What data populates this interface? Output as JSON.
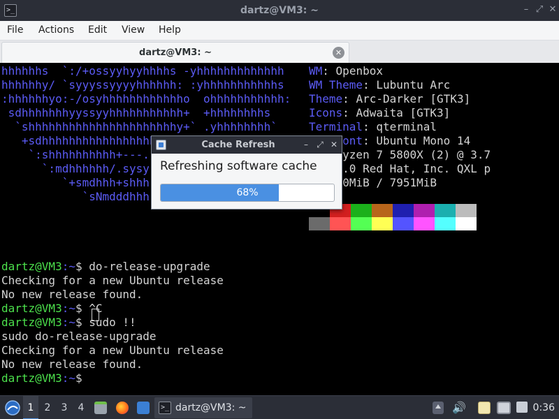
{
  "window": {
    "title": "dartz@VM3: ~",
    "app_icon": "terminal-icon",
    "controls": [
      "minimize-icon",
      "maximize-icon",
      "close-icon"
    ]
  },
  "menu": {
    "items": [
      "File",
      "Actions",
      "Edit",
      "View",
      "Help"
    ]
  },
  "tab": {
    "title": "dartz@VM3: ~",
    "close_icon": "tab-close-icon"
  },
  "terminal": {
    "logo_lines": [
      "hhhhhhs  `:/+ossyyhyyhhhhs -yhhhhhhhhhhhhh",
      "hhhhhhy/ `syyyssyyyyhhhhhh: :yhhhhhhhhhhhs",
      ":hhhhhhyo:-/osyhhhhhhhhhhhho  ohhhhhhhhhhh:",
      " sdhhhhhhhyyssyyhhhhhhhhhhh+  +hhhhhhhhs",
      "  `shhhhhhhhhhhhhhhhhhhhhhy+` .yhhhhhhhh`",
      "   +sdhhhhhhhhhhhhhhhhhhhh",
      "    `:shhhhhhhhhh+---.",
      "      `:mdhhhhhh/.sysy",
      "         `+smdhhh+shhh",
      "            `sNmdddhhh"
    ],
    "info": [
      {
        "key": "WM",
        "value": "Openbox"
      },
      {
        "key": "WM Theme",
        "value": "Lubuntu Arc"
      },
      {
        "key": "Theme",
        "value": "Arc-Darker [GTK3]"
      },
      {
        "key": "Icons",
        "value": "Adwaita [GTK3]"
      },
      {
        "key": "Terminal",
        "value": "qterminal"
      },
      {
        "key": "nal Font",
        "value": "Ubuntu Mono 14"
      },
      {
        "key": "",
        "value": "AMD Ryzen 7 5800X (2) @ 3.7"
      },
      {
        "key": "",
        "value": "00:01.0 Red Hat, Inc. QXL p"
      },
      {
        "key": "y",
        "value": "350MiB / 7951MiB"
      }
    ],
    "info_separators": [
      ":",
      ":",
      ":",
      ":",
      ":",
      ":",
      "",
      "",
      ":"
    ],
    "palette_top": [
      "#000000",
      "#d21f1f",
      "#1bb01b",
      "#b8651b",
      "#1f1fb0",
      "#b01fb0",
      "#1bb0b0",
      "#bcbcbc"
    ],
    "palette_bottom": [
      "#6b6b6b",
      "#ff5454",
      "#54ff54",
      "#ffff54",
      "#5454ff",
      "#ff54ff",
      "#54ffff",
      "#ffffff"
    ],
    "prompt_user": "dartz@VM3",
    "prompt_path": ":~",
    "prompt_symbol": "$ ",
    "lines": [
      {
        "type": "prompt",
        "cmd": "do-release-upgrade"
      },
      {
        "type": "out",
        "text": "Checking for a new Ubuntu release"
      },
      {
        "type": "out",
        "text": "No new release found."
      },
      {
        "type": "prompt",
        "cmd": "^C"
      },
      {
        "type": "prompt",
        "cmd": "sudo !!"
      },
      {
        "type": "out",
        "text": "sudo do-release-upgrade"
      },
      {
        "type": "out",
        "text": "Checking for a new Ubuntu release"
      },
      {
        "type": "out",
        "text": "No new release found."
      },
      {
        "type": "prompt",
        "cmd": ""
      }
    ]
  },
  "dialog": {
    "title": "Cache Refresh",
    "icon": "package-icon",
    "message": "Refreshing software cache",
    "progress_label": "68%",
    "progress_value": 0.68
  },
  "taskbar": {
    "start_icon": "lubuntu-menu-icon",
    "workspaces": [
      "1",
      "2",
      "3",
      "4"
    ],
    "active_workspace": "1",
    "launchers": [
      "file-manager-icon",
      "firefox-icon",
      "show-desktop-icon"
    ],
    "task_label": "dartz@VM3: ~",
    "tray": [
      "tray-arrow-icon",
      "volume-icon",
      "clipboard-icon",
      "network-icon",
      "update-notifier-icon"
    ],
    "clock": "0:36"
  }
}
